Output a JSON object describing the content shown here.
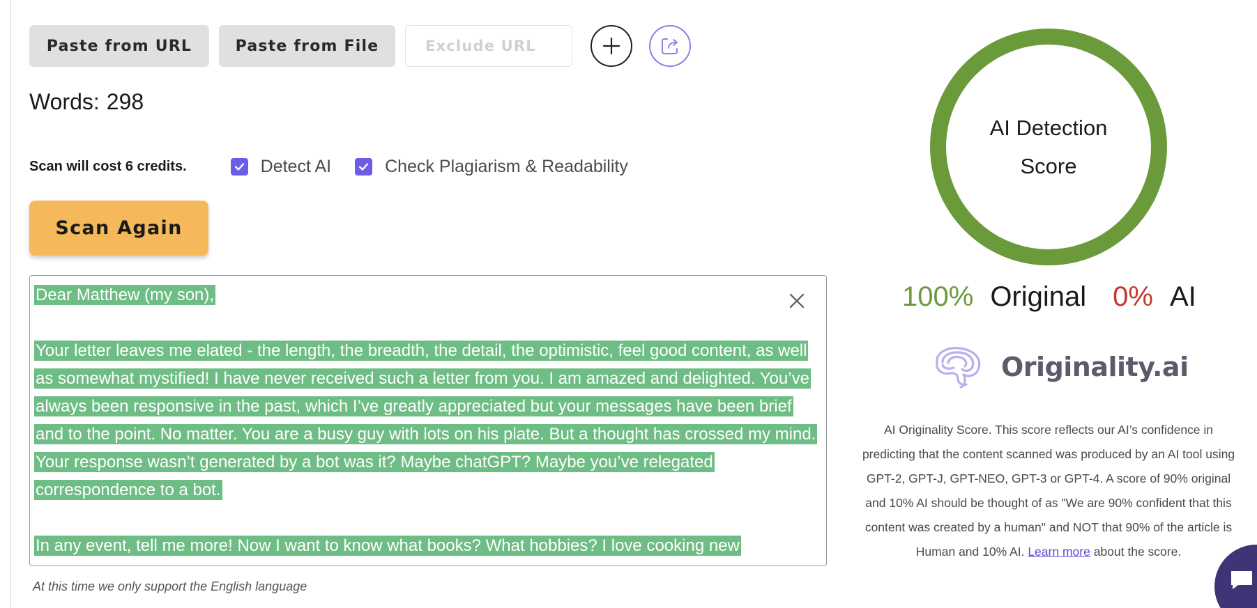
{
  "toolbar": {
    "paste_url_label": "Paste from URL",
    "paste_file_label": "Paste from File",
    "exclude_placeholder": "Exclude URL",
    "add_icon": "plus-icon",
    "share_icon": "share-export-icon"
  },
  "words": {
    "label": "Words:",
    "count": "298"
  },
  "scan_options": {
    "cost_text": "Scan will cost 6 credits.",
    "detect_ai": {
      "label": "Detect AI",
      "checked": true
    },
    "plagiarism": {
      "label": "Check Plagiarism & Readability",
      "checked": true
    }
  },
  "scan_button_label": "Scan Again",
  "content": {
    "paragraphs": [
      "Dear Matthew (my son),",
      "Your letter leaves me elated - the length, the breadth, the detail, the optimistic, feel good content, as well as somewhat mystified! I have never received such a letter from you. I am amazed and delighted. You’ve always been responsive in the past, which I’ve greatly appreciated but your messages have been brief and to the point. No matter. You are a busy guy with lots on his plate. But a thought has crossed my mind. Your response wasn’t generated by a bot was it? Maybe chatGPT? Maybe you’ve relegated correspondence to a bot.",
      "In any event, tell me more! Now I want to know what books? What hobbies?  I love cooking new"
    ],
    "highlight_color": "#6ebd84",
    "close_icon": "close-icon"
  },
  "language_notice": "At this time we only support the English language",
  "score_panel": {
    "ring_label": "AI Detection Score",
    "ring_color": "#6a9a3a",
    "original_value": "100%",
    "original_label": "Original",
    "ai_value": "0%",
    "ai_label": "AI",
    "original_color": "#6a9a3a",
    "ai_color": "#c0392b"
  },
  "brand": {
    "name": "Originality.ai",
    "logo_icon": "brain-logo-icon"
  },
  "explanation": {
    "text": "AI Originality Score. This score reflects our AI’s confidence in predicting that the content scanned was produced by an AI tool using GPT-2, GPT-J, GPT-NEO, GPT-3 or GPT-4. A score of 90% original and 10% AI should be thought of as \"We are 90% confident that this content was created by a human\" and NOT that 90% of the article is Human and 10% AI. ",
    "link_text": "Learn more",
    "after_link": " about the score."
  },
  "chat_widget_icon": "chat-icon"
}
